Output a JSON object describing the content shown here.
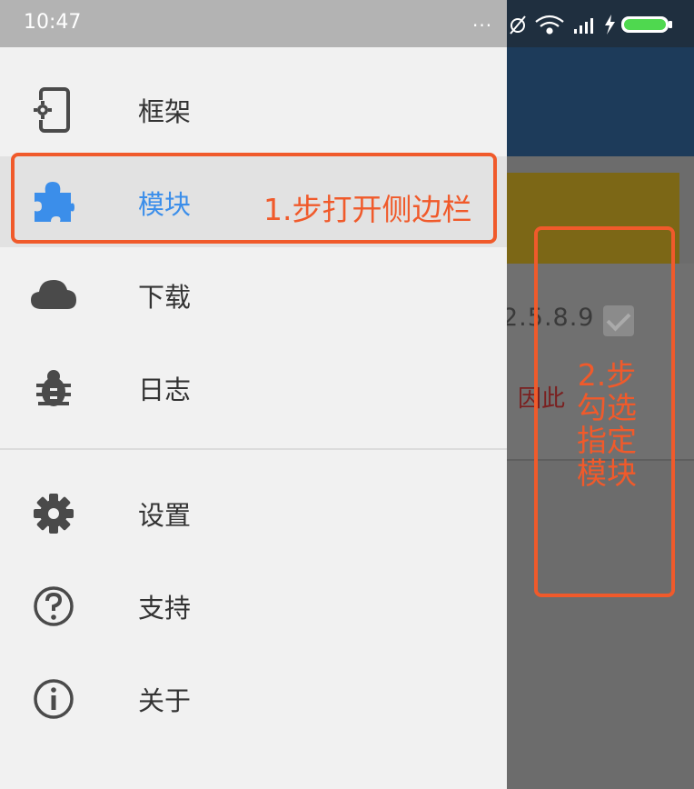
{
  "status_bar": {
    "time": "10:47",
    "overflow": "...",
    "icons": [
      "alarm-off-icon",
      "wifi-icon",
      "signal-icon",
      "charging-icon",
      "battery-icon"
    ]
  },
  "background_app": {
    "version_text": "2.5.8.9",
    "reason_text": "因此",
    "accent_color": "#1d3b5a",
    "banner_color": "#b89a1e"
  },
  "drawer": {
    "items": [
      {
        "id": "framework",
        "label": "框架",
        "icon": "phone-settings-icon",
        "selected": false
      },
      {
        "id": "modules",
        "label": "模块",
        "icon": "puzzle-icon",
        "selected": true
      },
      {
        "id": "download",
        "label": "下载",
        "icon": "cloud-icon",
        "selected": false
      },
      {
        "id": "logs",
        "label": "日志",
        "icon": "bug-icon",
        "selected": false
      },
      {
        "id": "settings",
        "label": "设置",
        "icon": "gear-icon",
        "selected": false
      },
      {
        "id": "support",
        "label": "支持",
        "icon": "help-icon",
        "selected": false
      },
      {
        "id": "about",
        "label": "关于",
        "icon": "info-icon",
        "selected": false
      }
    ],
    "selected_color": "#3b8eea"
  },
  "annotations": {
    "step1": "1.步打开侧边栏",
    "step2_lines": [
      "2.步",
      "勾选",
      "指定",
      "模块"
    ],
    "color": "#f05a2b"
  }
}
